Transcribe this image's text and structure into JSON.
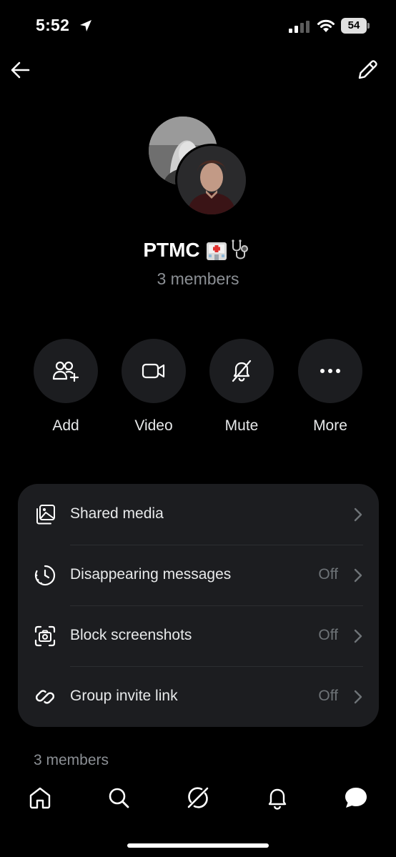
{
  "status": {
    "time": "5:52",
    "battery": "54"
  },
  "group": {
    "name": "PTMC",
    "members_label": "3 members"
  },
  "actions": [
    {
      "label": "Add",
      "icon": "add-people-icon"
    },
    {
      "label": "Video",
      "icon": "video-camera-icon"
    },
    {
      "label": "Mute",
      "icon": "bell-off-icon"
    },
    {
      "label": "More",
      "icon": "more-dots-icon"
    }
  ],
  "settings": [
    {
      "label": "Shared media",
      "value": "",
      "icon": "shared-media-icon"
    },
    {
      "label": "Disappearing messages",
      "value": "Off",
      "icon": "timer-icon"
    },
    {
      "label": "Block screenshots",
      "value": "Off",
      "icon": "screenshot-camera-icon"
    },
    {
      "label": "Group invite link",
      "value": "Off",
      "icon": "link-icon"
    }
  ],
  "members_section": {
    "title": "3 members"
  },
  "nav": [
    "home-icon",
    "search-icon",
    "grok-icon",
    "notifications-bell-icon",
    "messages-icon"
  ],
  "colors": {
    "background": "#000000",
    "surface": "#1c1d20",
    "text": "#e7e9ea",
    "muted": "#8b8f94"
  }
}
